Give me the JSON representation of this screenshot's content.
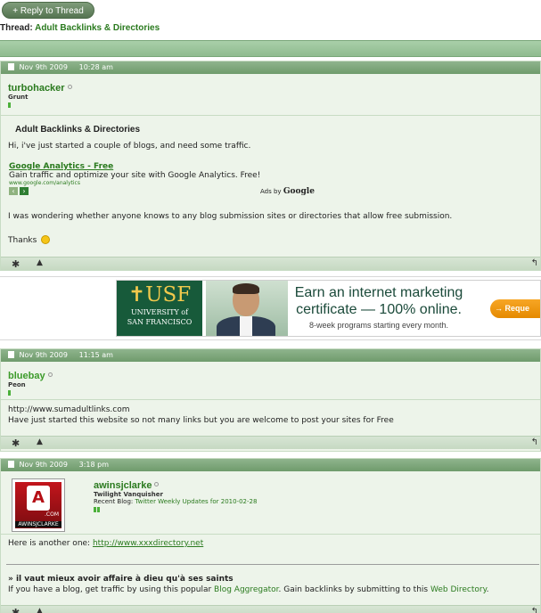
{
  "toolbar": {
    "reply_label": "+ Reply to Thread"
  },
  "thread": {
    "label": "Thread:",
    "title": "Adult Backlinks & Directories"
  },
  "posts": [
    {
      "date": "Nov 9th 2009",
      "time": "10:28 am",
      "username": "turbohacker",
      "user_title": "Grunt",
      "post_title": "Adult Backlinks & Directories",
      "body_1": "Hi, i've just started a couple of blogs, and need some traffic.",
      "body_2": "I was wondering whether anyone knows to any blog submission sites or directories that allow free submission.",
      "body_3": "Thanks",
      "ad": {
        "title": "Google Analytics - Free",
        "desc": "Gain traffic and optimize your site with Google Analytics. Free!",
        "url": "www.google.com/analytics",
        "ads_by": "Ads by",
        "google": "Google"
      }
    },
    {
      "date": "Nov 9th 2009",
      "time": "11:15 am",
      "username": "bluebay",
      "user_title": "Peon",
      "body_1": "http://www.sumadultlinks.com",
      "body_2": "Have just started this website so not many links but you are welcome to post your sites for Free"
    },
    {
      "date": "Nov 9th 2009",
      "time": "3:18 pm",
      "username": "awinsjclarke",
      "user_title": "Twilight Vanquisher",
      "recent_blog_label": "Recent Blog:",
      "recent_blog": "Twitter Weekly Updates for 2010-02-28",
      "avatar_com": ".COM",
      "avatar_name": "AWINSJCLARKE",
      "body_1": "Here is another one:",
      "body_link": "http://www.xxxdirectory.net",
      "sig_1": "» il vaut mieux avoir affaire à dieu qu'à ses saints",
      "sig_2a": "If you have a blog, get traffic by using this popular",
      "sig_link_1": "Blog Aggregator",
      "sig_2b": ". Gain backlinks by submitting to this",
      "sig_link_2": "Web Directory",
      "sig_2c": "."
    }
  ],
  "banner": {
    "usf_big": "✝USF",
    "usf_small_1": "UNIVERSITY of",
    "usf_small_2": "SAN FRANCISCO",
    "line_1": "Earn an internet marketing",
    "line_2": "certificate — 100% online.",
    "line_3": "8-week programs starting every month.",
    "button": "→ Reque"
  },
  "colors": {
    "accent": "#2a7a1e",
    "header": "#7aa77a",
    "post_bg": "#edf4ea"
  }
}
